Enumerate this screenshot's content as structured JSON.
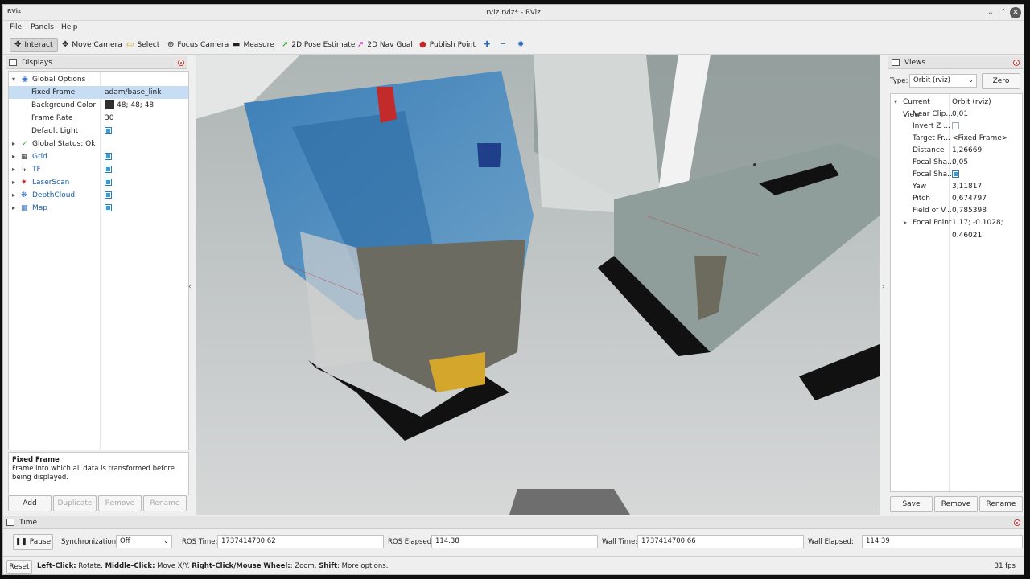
{
  "window": {
    "logo": "RViz",
    "title": "rviz.rviz* - RViz"
  },
  "menu": [
    "File",
    "Panels",
    "Help"
  ],
  "toolbar": {
    "interact": "Interact",
    "move_camera": "Move Camera",
    "select": "Select",
    "focus_camera": "Focus Camera",
    "measure": "Measure",
    "pose_estimate": "2D Pose Estimate",
    "nav_goal": "2D Nav Goal",
    "publish_point": "Publish Point"
  },
  "displays": {
    "title": "Displays",
    "global_options": "Global Options",
    "fixed_frame_label": "Fixed Frame",
    "fixed_frame_value": "adam/base_link",
    "background_color_label": "Background Color",
    "background_color_value": "48; 48; 48",
    "frame_rate_label": "Frame Rate",
    "frame_rate_value": "30",
    "default_light_label": "Default Light",
    "global_status": "Global Status: Ok",
    "items": [
      {
        "label": "Grid",
        "icon": "grid-icon",
        "enabled": true
      },
      {
        "label": "TF",
        "icon": "tf-icon",
        "enabled": true
      },
      {
        "label": "LaserScan",
        "icon": "laserscan-icon",
        "enabled": true
      },
      {
        "label": "DepthCloud",
        "icon": "depthcloud-icon",
        "enabled": true
      },
      {
        "label": "Map",
        "icon": "map-icon",
        "enabled": true
      }
    ],
    "desc_title": "Fixed Frame",
    "desc_text": "Frame into which all data is transformed before being displayed.",
    "buttons": {
      "add": "Add",
      "duplicate": "Duplicate",
      "remove": "Remove",
      "rename": "Rename"
    }
  },
  "views": {
    "title": "Views",
    "type_label": "Type:",
    "type_value": "Orbit (rviz)",
    "zero": "Zero",
    "current_view_label": "Current View",
    "current_view_value": "Orbit (rviz)",
    "props": [
      {
        "label": "Near Clip...",
        "value": "0,01"
      },
      {
        "label": "Invert Z ...",
        "value": ""
      },
      {
        "label": "Target Fr...",
        "value": "<Fixed Frame>"
      },
      {
        "label": "Distance",
        "value": "1,26669"
      },
      {
        "label": "Focal Sha...",
        "value": "0,05"
      },
      {
        "label": "Focal Sha...",
        "value": ""
      },
      {
        "label": "Yaw",
        "value": "3,11817"
      },
      {
        "label": "Pitch",
        "value": "0,674797"
      },
      {
        "label": "Field of V...",
        "value": "0,785398"
      },
      {
        "label": "Focal Point",
        "value": "1.17; -0.1028; 0.46021"
      }
    ],
    "buttons": {
      "save": "Save",
      "remove": "Remove",
      "rename": "Rename"
    }
  },
  "time": {
    "title": "Time",
    "pause": "Pause",
    "sync_label": "Synchronization:",
    "sync_value": "Off",
    "ros_time_label": "ROS Time:",
    "ros_time": "1737414700.62",
    "ros_elapsed_label": "ROS Elapsed:",
    "ros_elapsed": "114.38",
    "wall_time_label": "Wall Time:",
    "wall_time": "1737414700.66",
    "wall_elapsed_label": "Wall Elapsed:",
    "wall_elapsed": "114.39"
  },
  "status": {
    "reset": "Reset",
    "left_click": "Left-Click:",
    "left_desc": " Rotate. ",
    "middle_click": "Middle-Click:",
    "middle_desc": " Move X/Y. ",
    "right_click": "Right-Click/Mouse Wheel:",
    "right_desc": ": Zoom. ",
    "shift": "Shift",
    "shift_desc": ": More options.",
    "fps": "31 fps"
  },
  "colors": {
    "accent": "#3a9bd8",
    "selection": "#c6ddf4",
    "link_blue": "#1a5ea8"
  }
}
